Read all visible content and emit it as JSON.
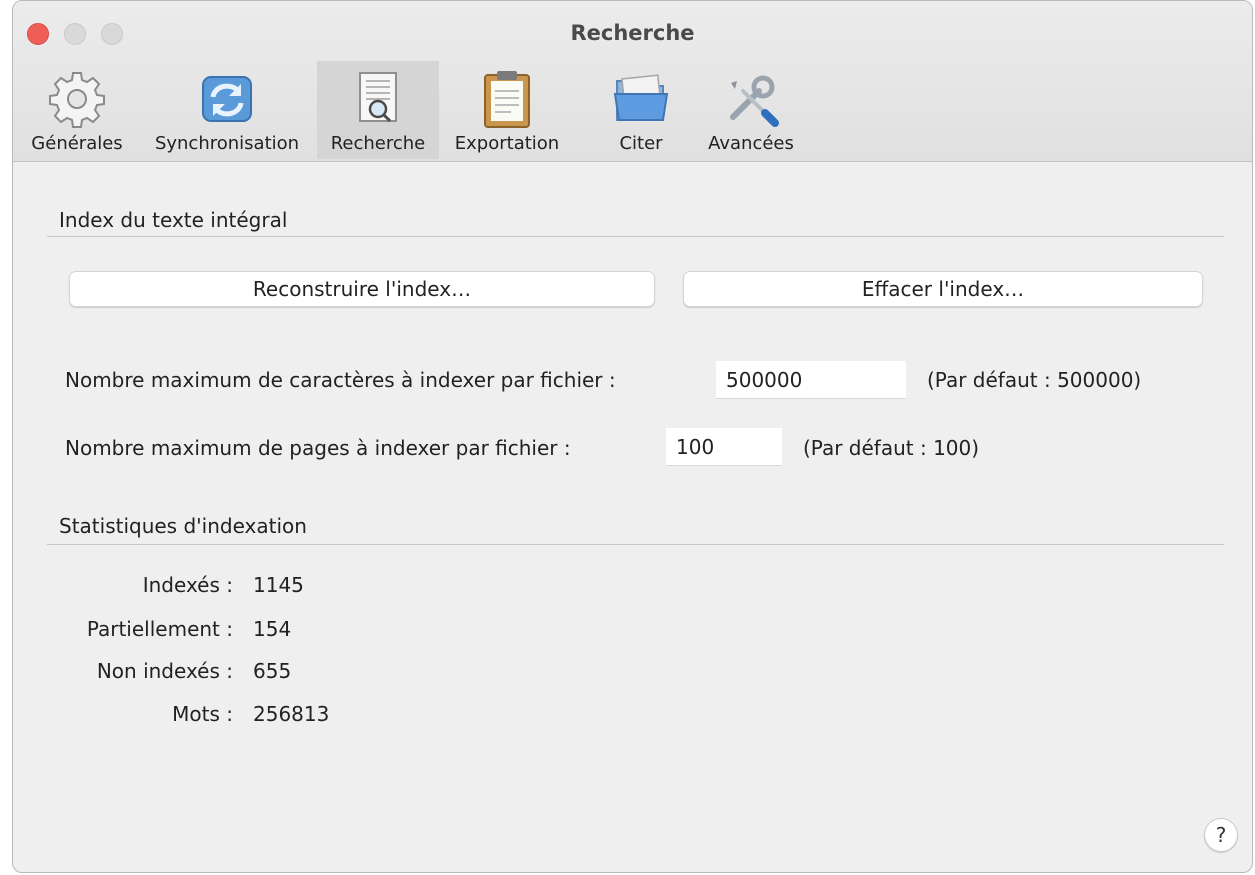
{
  "window": {
    "title": "Recherche"
  },
  "toolbar": {
    "tabs": [
      {
        "label": "Générales",
        "icon": "gear-icon"
      },
      {
        "label": "Synchronisation",
        "icon": "sync-icon"
      },
      {
        "label": "Recherche",
        "icon": "search-document-icon",
        "active": true
      },
      {
        "label": "Exportation",
        "icon": "clipboard-icon"
      },
      {
        "label": "Citer",
        "icon": "folder-icon"
      },
      {
        "label": "Avancées",
        "icon": "tools-icon"
      }
    ]
  },
  "fulltext": {
    "title": "Index du texte intégral",
    "rebuild_button": "Reconstruire l'index…",
    "clear_button": "Effacer l'index…",
    "max_chars": {
      "label": "Nombre maximum de caractères à indexer par fichier :",
      "value": "500000",
      "default": "(Par défaut : 500000)"
    },
    "max_pages": {
      "label": "Nombre maximum de pages à indexer par fichier :",
      "value": "100",
      "default": "(Par défaut : 100)"
    }
  },
  "stats": {
    "title": "Statistiques d'indexation",
    "rows": [
      {
        "label": "Indexés :",
        "value": "1145"
      },
      {
        "label": "Partiellement :",
        "value": "154"
      },
      {
        "label": "Non indexés :",
        "value": "655"
      },
      {
        "label": "Mots :",
        "value": "256813"
      }
    ]
  },
  "help": {
    "label": "?"
  },
  "colors": {
    "close": "#ee5e57",
    "window_bg": "#efefef",
    "active_tab": "#d5d5d5"
  }
}
